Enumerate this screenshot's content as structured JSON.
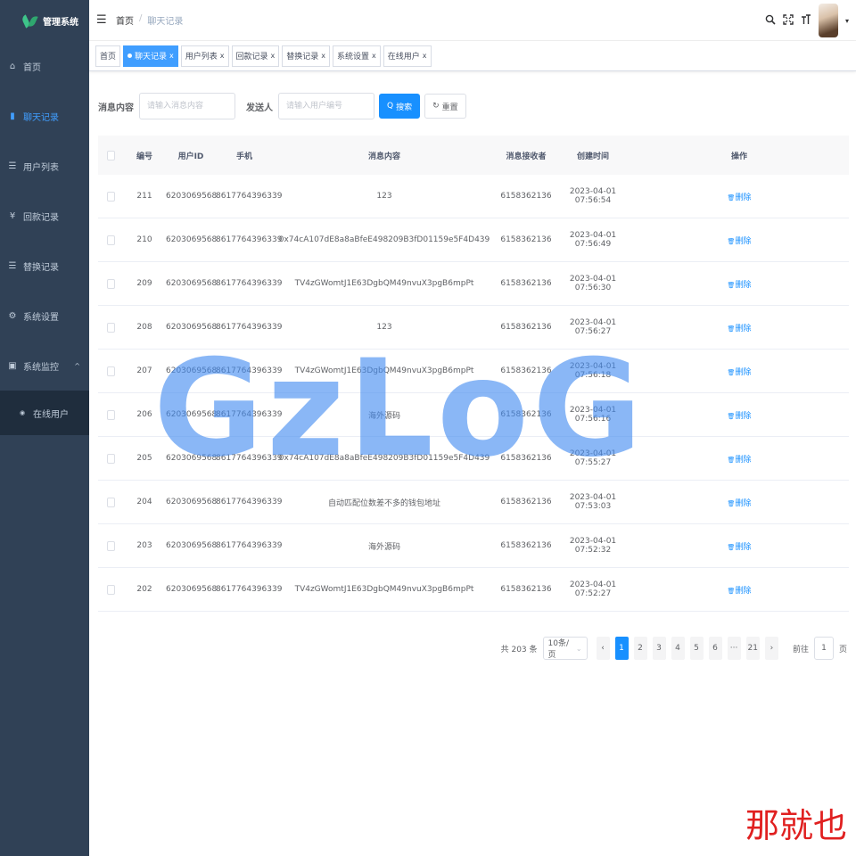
{
  "sidebar": {
    "logo_text": "管理系统",
    "items": [
      {
        "icon": "⌂",
        "label": "首页"
      },
      {
        "icon": "▮",
        "label": "聊天记录"
      },
      {
        "icon": "☰",
        "label": "用户列表"
      },
      {
        "icon": "¥",
        "label": "回款记录"
      },
      {
        "icon": "☰",
        "label": "替换记录"
      },
      {
        "icon": "⚙",
        "label": "系统设置"
      },
      {
        "icon": "▣",
        "label": "系统监控",
        "arrow": "^"
      }
    ],
    "submenu": [
      {
        "icon": "◉",
        "label": "在线用户"
      }
    ]
  },
  "navbar": {
    "hamburger": "☰",
    "breadcrumb_home": "首页",
    "breadcrumb_sep": "/",
    "breadcrumb_current": "聊天记录",
    "icons": [
      "search-icon",
      "fullscreen-icon",
      "font-size-icon"
    ],
    "caret": "▾"
  },
  "tags": [
    {
      "label": "首页",
      "active": false,
      "closable": false
    },
    {
      "label": "聊天记录",
      "active": true,
      "closable": true
    },
    {
      "label": "用户列表",
      "active": false,
      "closable": true
    },
    {
      "label": "回款记录",
      "active": false,
      "closable": true
    },
    {
      "label": "替换记录",
      "active": false,
      "closable": true
    },
    {
      "label": "系统设置",
      "active": false,
      "closable": true
    },
    {
      "label": "在线用户",
      "active": false,
      "closable": true
    }
  ],
  "tag_close": "x",
  "search": {
    "msg_label": "消息内容",
    "msg_placeholder": "请输入消息内容",
    "sender_label": "发送人",
    "sender_placeholder": "请输入用户编号",
    "search_btn": "搜索",
    "search_icon": "Q",
    "reset_btn": "重置",
    "reset_icon": "↻"
  },
  "table": {
    "headers": [
      "编号",
      "用户ID",
      "手机",
      "消息内容",
      "消息接收者",
      "创建时间",
      "操作"
    ],
    "delete_label": "删除",
    "delete_icon": "🗑",
    "rows": [
      {
        "id": "211",
        "uid": "6203069568",
        "phone": "8617764396339",
        "msg": "123",
        "receiver": "6158362136",
        "time": "2023-04-01 07:56:54"
      },
      {
        "id": "210",
        "uid": "6203069568",
        "phone": "8617764396339",
        "msg": "0x74cA107dE8a8aBfeE498209B3fD01159e5F4D439",
        "receiver": "6158362136",
        "time": "2023-04-01 07:56:49"
      },
      {
        "id": "209",
        "uid": "6203069568",
        "phone": "8617764396339",
        "msg": "TV4zGWomtJ1E63DgbQM49nvuX3pgB6mpPt",
        "receiver": "6158362136",
        "time": "2023-04-01 07:56:30"
      },
      {
        "id": "208",
        "uid": "6203069568",
        "phone": "8617764396339",
        "msg": "123",
        "receiver": "6158362136",
        "time": "2023-04-01 07:56:27"
      },
      {
        "id": "207",
        "uid": "6203069568",
        "phone": "8617764396339",
        "msg": "TV4zGWomtJ1E63DgbQM49nvuX3pgB6mpPt",
        "receiver": "6158362136",
        "time": "2023-04-01 07:56:18"
      },
      {
        "id": "206",
        "uid": "6203069568",
        "phone": "8617764396339",
        "msg": "海外源码",
        "receiver": "6158362136",
        "time": "2023-04-01 07:56:16"
      },
      {
        "id": "205",
        "uid": "6203069568",
        "phone": "8617764396339",
        "msg": "0x74cA107dE8a8aBfeE498209B3fD01159e5F4D439",
        "receiver": "6158362136",
        "time": "2023-04-01 07:55:27"
      },
      {
        "id": "204",
        "uid": "6203069568",
        "phone": "8617764396339",
        "msg": "自动匹配位数差不多的钱包地址",
        "receiver": "6158362136",
        "time": "2023-04-01 07:53:03"
      },
      {
        "id": "203",
        "uid": "6203069568",
        "phone": "8617764396339",
        "msg": "海外源码",
        "receiver": "6158362136",
        "time": "2023-04-01 07:52:32"
      },
      {
        "id": "202",
        "uid": "6203069568",
        "phone": "8617764396339",
        "msg": "TV4zGWomtJ1E63DgbQM49nvuX3pgB6mpPt",
        "receiver": "6158362136",
        "time": "2023-04-01 07:52:27"
      }
    ]
  },
  "pagination": {
    "total": "共 203 条",
    "page_size": "10条/页",
    "prev": "‹",
    "next": "›",
    "pages": [
      "1",
      "2",
      "3",
      "4",
      "5",
      "6",
      "···",
      "21"
    ],
    "current": "1",
    "goto_prefix": "前往",
    "goto_value": "1",
    "goto_suffix": "页"
  },
  "watermark": {
    "text": "GzLoG",
    "cn_text": "那就也"
  },
  "colors": {
    "sidebar_bg": "#304156",
    "primary": "#1890ff",
    "active_menu": "#409eff",
    "watermark": "#428bf0",
    "watermark_cn": "#e02020"
  }
}
